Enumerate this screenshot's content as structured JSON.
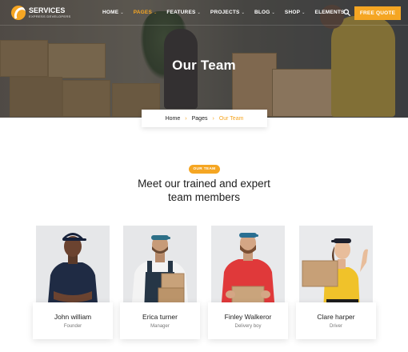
{
  "brand": {
    "name": "SERVICES",
    "tagline": "EXPRESS DEVELOPERS"
  },
  "nav": {
    "items": [
      {
        "label": "HOME",
        "active": false
      },
      {
        "label": "PAGES",
        "active": true
      },
      {
        "label": "FEATURES",
        "active": false
      },
      {
        "label": "PROJECTS",
        "active": false
      },
      {
        "label": "BLOG",
        "active": false
      },
      {
        "label": "SHOP",
        "active": false
      },
      {
        "label": "ELEMENTS",
        "active": false
      }
    ],
    "quote_button": "FREE QUOTE",
    "search_icon": "search-icon"
  },
  "hero": {
    "title": "Our Team"
  },
  "breadcrumb": {
    "home": "Home",
    "pages": "Pages",
    "current": "Our Team"
  },
  "section": {
    "badge": "OUR TEAM",
    "heading_line1": "Meet our trained and expert",
    "heading_line2": "team members"
  },
  "team": [
    {
      "name": "John william",
      "role": "Founder"
    },
    {
      "name": "Erica turner",
      "role": "Manager"
    },
    {
      "name": "Finley Walkeror",
      "role": "Delivery boy"
    },
    {
      "name": "Clare harper",
      "role": "Driver"
    }
  ],
  "colors": {
    "accent": "#f5a623",
    "heading": "#1d1d1d",
    "muted": "#777777"
  }
}
